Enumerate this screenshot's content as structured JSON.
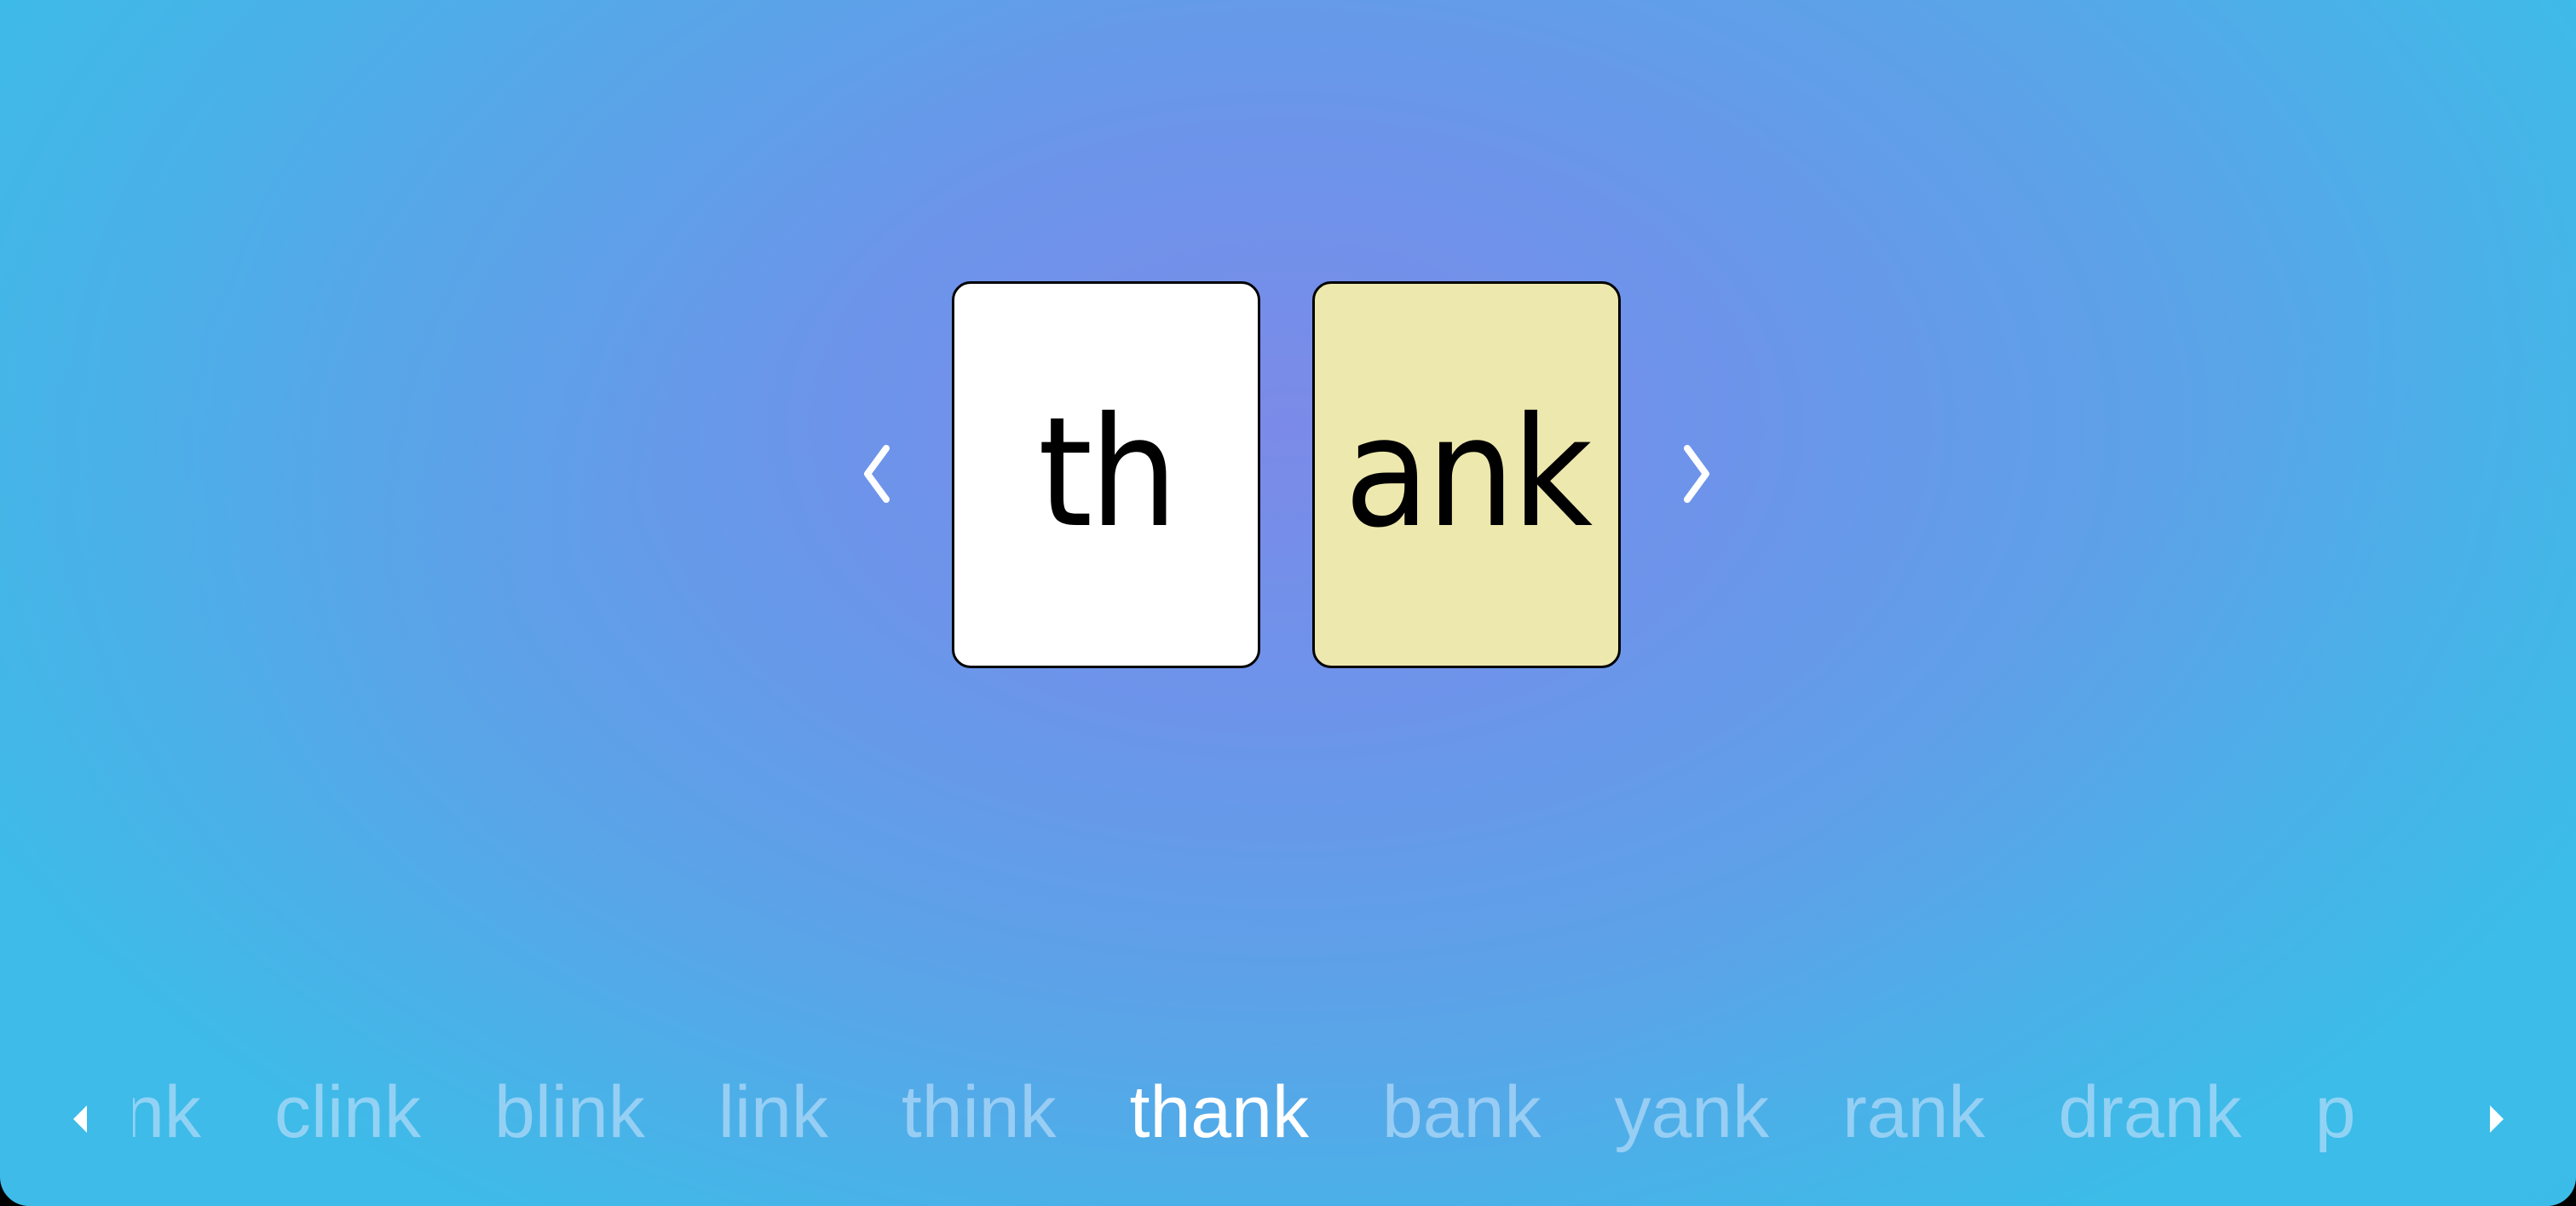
{
  "colors": {
    "onset_card": "#ffffff",
    "rime_card": "#ede8ad",
    "card_border": "#000000",
    "word_inactive": "#bedefa",
    "word_active": "#ffffff"
  },
  "flashcards": {
    "onset": "th",
    "rime": "ank"
  },
  "navigation": {
    "prev_icon": "chevron-left-icon",
    "next_icon": "chevron-right-icon"
  },
  "word_strip": {
    "prev_icon": "triangle-left-icon",
    "next_icon": "triangle-right-icon",
    "current_index": 5,
    "words": [
      {
        "label": "ink"
      },
      {
        "label": "clink"
      },
      {
        "label": "blink"
      },
      {
        "label": "link"
      },
      {
        "label": "think"
      },
      {
        "label": "thank"
      },
      {
        "label": "bank"
      },
      {
        "label": "yank"
      },
      {
        "label": "rank"
      },
      {
        "label": "drank"
      },
      {
        "label": "p"
      }
    ]
  }
}
